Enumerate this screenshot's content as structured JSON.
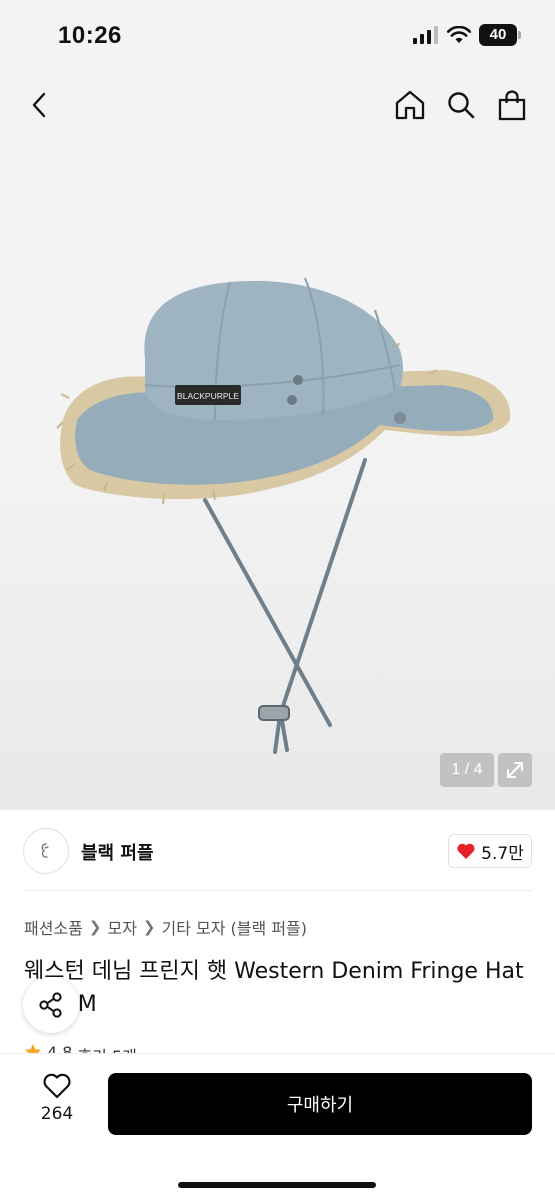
{
  "status": {
    "time": "10:26",
    "battery": "40"
  },
  "gallery": {
    "page": "1 / 4"
  },
  "shop": {
    "name": "블랙 퍼플",
    "likes": "5.7만"
  },
  "breadcrumb": [
    "패션소품",
    "모자",
    "기타 모자 (블랙 퍼플)"
  ],
  "product": {
    "title": "웨스턴 데님 프린지 햇 Western Denim Fringe Hat DENIM",
    "hat_label": "BLACKPURPLE",
    "rating": "4.8",
    "reviews": "후기 5개"
  },
  "bottom": {
    "wish_count": "264",
    "buy_label": "구매하기"
  },
  "colors": {
    "heart": "#e8202a",
    "star": "#f5a623",
    "buy_button": "#000000"
  },
  "icons": [
    "back-icon",
    "home-icon",
    "search-icon",
    "bag-icon",
    "expand-icon",
    "heart-icon",
    "share-icon",
    "star-icon",
    "heart-outline-icon"
  ]
}
